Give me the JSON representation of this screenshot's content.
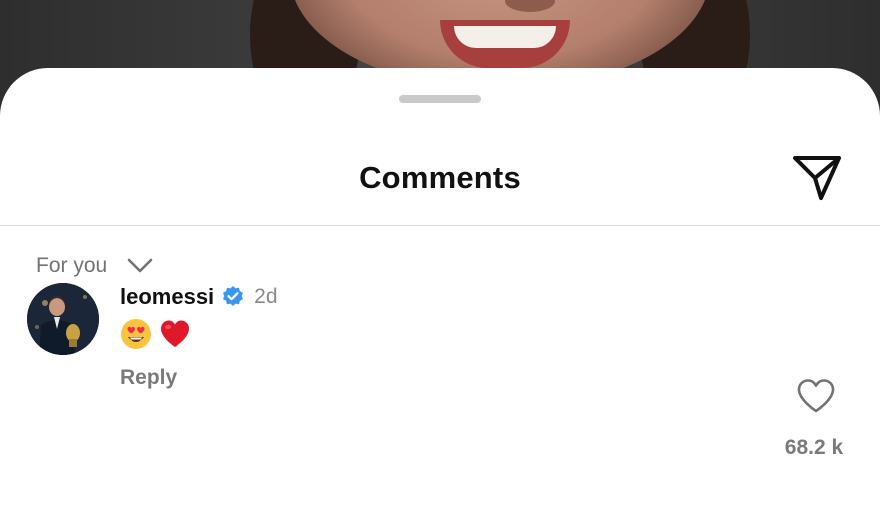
{
  "header": {
    "title": "Comments",
    "share_icon": "paper-plane-icon"
  },
  "sort": {
    "label": "For you",
    "icon": "chevron-down-icon"
  },
  "comment": {
    "username": "leomessi",
    "verified": true,
    "time": "2d",
    "emojis": [
      "smiling-face-with-heart-eyes",
      "red-heart"
    ],
    "reply_label": "Reply",
    "like_count": "68.2 k",
    "like_icon": "heart-outline-icon"
  },
  "colors": {
    "sheet": "#ffffff",
    "title": "#111111",
    "secondary_text": "#737373",
    "verified_badge": "#3797f0",
    "divider": "#dcdcdc"
  }
}
